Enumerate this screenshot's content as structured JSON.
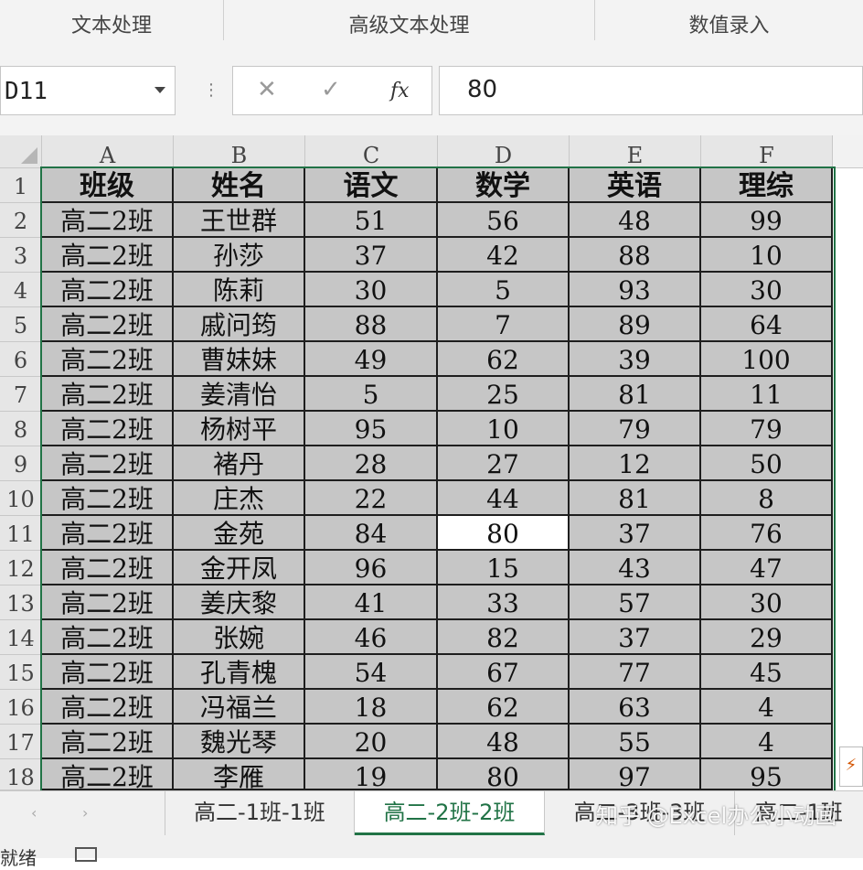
{
  "ribbon": {
    "groups": [
      "文本处理",
      "高级文本处理",
      "数值录入"
    ]
  },
  "formula_bar": {
    "name_box": "D11",
    "cancel_glyph": "✕",
    "enter_glyph": "✓",
    "fx_label": "fx",
    "formula": "80"
  },
  "sheet": {
    "columns": [
      "A",
      "B",
      "C",
      "D",
      "E",
      "F"
    ],
    "row_numbers": [
      "1",
      "2",
      "3",
      "4",
      "5",
      "6",
      "7",
      "8",
      "9",
      "10",
      "11",
      "12",
      "13",
      "14",
      "15",
      "16",
      "17",
      "18"
    ],
    "header": [
      "班级",
      "姓名",
      "语文",
      "数学",
      "英语",
      "理综"
    ],
    "rows": [
      [
        "高二2班",
        "王世群",
        "51",
        "56",
        "48",
        "99"
      ],
      [
        "高二2班",
        "孙莎",
        "37",
        "42",
        "88",
        "10"
      ],
      [
        "高二2班",
        "陈莉",
        "30",
        "5",
        "93",
        "30"
      ],
      [
        "高二2班",
        "戚问筠",
        "88",
        "7",
        "89",
        "64"
      ],
      [
        "高二2班",
        "曹妹妹",
        "49",
        "62",
        "39",
        "100"
      ],
      [
        "高二2班",
        "姜清怡",
        "5",
        "25",
        "81",
        "11"
      ],
      [
        "高二2班",
        "杨树平",
        "95",
        "10",
        "79",
        "79"
      ],
      [
        "高二2班",
        "褚丹",
        "28",
        "27",
        "12",
        "50"
      ],
      [
        "高二2班",
        "庄杰",
        "22",
        "44",
        "81",
        "8"
      ],
      [
        "高二2班",
        "金苑",
        "84",
        "80",
        "37",
        "76"
      ],
      [
        "高二2班",
        "金开凤",
        "96",
        "15",
        "43",
        "47"
      ],
      [
        "高二2班",
        "姜庆黎",
        "41",
        "33",
        "57",
        "30"
      ],
      [
        "高二2班",
        "张婉",
        "46",
        "82",
        "37",
        "29"
      ],
      [
        "高二2班",
        "孔青槐",
        "54",
        "67",
        "77",
        "45"
      ],
      [
        "高二2班",
        "冯福兰",
        "18",
        "62",
        "63",
        "4"
      ],
      [
        "高二2班",
        "魏光琴",
        "20",
        "48",
        "55",
        "4"
      ],
      [
        "高二2班",
        "李雁",
        "19",
        "80",
        "97",
        "95"
      ]
    ],
    "active_cell": "D11"
  },
  "tabs": {
    "prev_glyph": "‹",
    "next_glyph": "›",
    "items": [
      "高二-1班-1班",
      "高二-2班-2班",
      "高二-3班-3班",
      "高二-1班"
    ],
    "active_index": 1
  },
  "watermark": "知乎 @Excel办公小动画",
  "status": {
    "text": "就绪"
  },
  "colors": {
    "selection_border": "#217346",
    "cell_fill": "#c6c6c6",
    "active_tab_text": "#217346"
  }
}
